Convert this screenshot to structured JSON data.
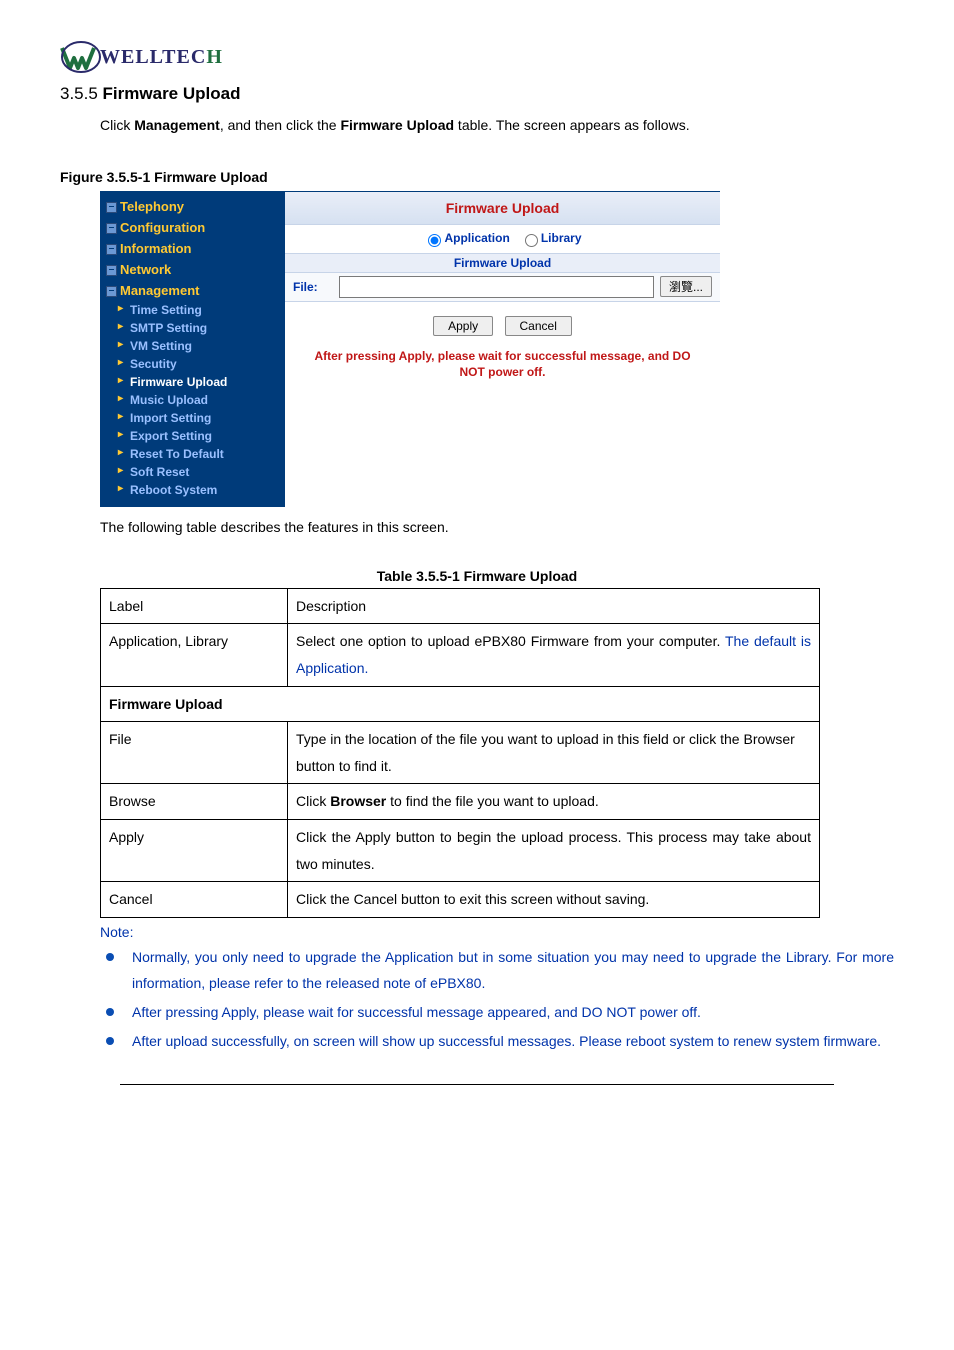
{
  "logo": {
    "text_main": "WELLTEC",
    "text_accent": "H"
  },
  "section": {
    "number": "3.5.5",
    "title": "Firmware Upload",
    "intro_pre": "Click ",
    "intro_b1": "Management",
    "intro_mid": ", and then click the ",
    "intro_b2": "Firmware Upload",
    "intro_post": " table. The screen appears as follows."
  },
  "figure": {
    "caption": "Figure   3.5.5-1 Firmware Upload"
  },
  "nav": {
    "top": [
      "Telephony",
      "Configuration",
      "Information",
      "Network",
      "Management"
    ],
    "sub": [
      "Time Setting",
      "SMTP Setting",
      "VM Setting",
      "Secutity",
      "Firmware Upload",
      "Music Upload",
      "Import Setting",
      "Export Setting",
      "Reset To Default",
      "Soft Reset",
      "Reboot System"
    ],
    "active_index": 4
  },
  "panel": {
    "title": "Firmware Upload",
    "radio_app": "Application",
    "radio_lib": "Library",
    "subhead": "Firmware Upload",
    "file_label": "File:",
    "browse_btn": "瀏覽...",
    "apply_btn": "Apply",
    "cancel_btn": "Cancel",
    "warning": "After pressing Apply, please wait for successful message, and DO NOT power off."
  },
  "after_shot": "The following table describes the features in this screen.",
  "table": {
    "caption": "Table 3.5.5-1 Firmware Upload",
    "head_label": "Label",
    "head_desc": "Description",
    "row1_label": "Application, Library",
    "row1_desc_a": "Select one option to upload ePBX80 Firmware from your computer. ",
    "row1_desc_b": "The default is Application.",
    "section": "Firmware Upload",
    "row2_label": "File",
    "row2_desc": "Type in the location of the file you want to upload in this field or click the Browser button to find it.",
    "row3_label": "Browse",
    "row3_desc_a": "Click ",
    "row3_desc_b": "Browser",
    "row3_desc_c": " to find the file you want to upload.",
    "row4_label": "Apply",
    "row4_desc": "Click the Apply button to begin the upload process. This process may take about two minutes.",
    "row5_label": "Cancel",
    "row5_desc": "Click the Cancel button to exit this screen without saving."
  },
  "notes": {
    "label": "Note:",
    "items": [
      "Normally, you only need to upgrade the Application but in some situation you may need to upgrade the Library. For more information, please refer to the released note of ePBX80.",
      "After pressing Apply, please wait for successful message appeared, and DO NOT power off.",
      "After upload successfully, on screen will show up successful messages. Please reboot system to renew system firmware."
    ]
  }
}
